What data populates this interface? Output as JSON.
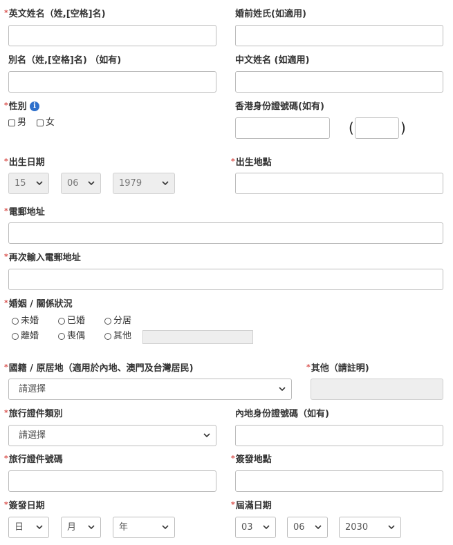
{
  "fields": {
    "english_name": {
      "label": "英文姓名（姓,[空格]名)",
      "required": true
    },
    "maiden_name": {
      "label": "婚前姓氏(如適用)",
      "required": false
    },
    "alias": {
      "label": "別名（姓,[空格]名) （如有)",
      "required": false
    },
    "chinese_name": {
      "label": "中文姓名 (如適用)",
      "required": false
    },
    "gender": {
      "label": "性別",
      "required": true,
      "options": [
        "男",
        "女"
      ]
    },
    "hkid": {
      "label": "香港身份證號碼(如有)",
      "required": false,
      "open_paren": "(",
      "close_paren": ")"
    },
    "dob": {
      "label": "出生日期",
      "required": true,
      "day": "15",
      "month": "06",
      "year": "1979"
    },
    "birthplace": {
      "label": "出生地點",
      "required": true
    },
    "email": {
      "label": "電郵地址",
      "required": true
    },
    "email_confirm": {
      "label": "再次輸入電郵地址",
      "required": true
    },
    "marital": {
      "label": "婚姻 / 關係狀況",
      "required": true,
      "options": [
        "未婚",
        "已婚",
        "分居",
        "離婚",
        "喪偶",
        "其他"
      ]
    },
    "nationality": {
      "label": "國籍 / 原居地（適用於內地、澳門及台灣居民)",
      "required": true,
      "value": "請選擇"
    },
    "nationality_other": {
      "label": "其他（請註明)",
      "required": true
    },
    "doc_type": {
      "label": "旅行證件類別",
      "required": true,
      "value": "請選擇"
    },
    "mainland_id": {
      "label": "內地身份證號碼（如有)",
      "required": false
    },
    "doc_number": {
      "label": "旅行證件號碼",
      "required": true
    },
    "issue_place": {
      "label": "簽發地點",
      "required": true
    },
    "issue_date": {
      "label": "簽發日期",
      "required": true,
      "day": "日",
      "month": "月",
      "year": "年"
    },
    "expiry_date": {
      "label": "屆滿日期",
      "required": true,
      "day": "03",
      "month": "06",
      "year": "2030"
    }
  },
  "required_mark": "*",
  "info_glyph": "i",
  "icons": {
    "info": "info-circle-icon",
    "dropdown": "chevron-down-icon"
  },
  "colors": {
    "required": "#d9534f",
    "info": "#2d6fcb",
    "border": "#bcbcbc",
    "disabled_bg": "#eeeeee"
  }
}
